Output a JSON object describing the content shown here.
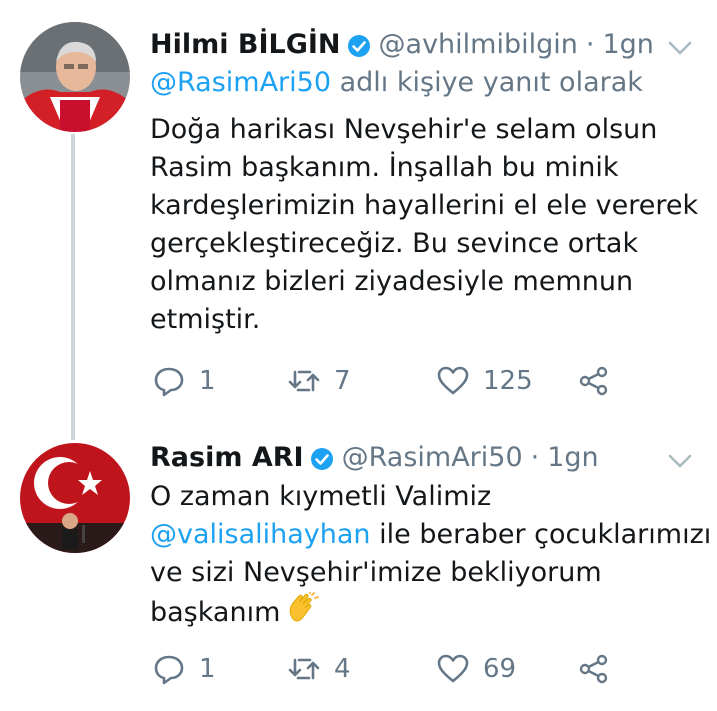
{
  "tweets": [
    {
      "name": "Hilmi BİLGİN",
      "handle": "@avhilmibilgin",
      "separator": "·",
      "time": "1gn",
      "reply_prefix_mention": "@RasimAri50",
      "reply_suffix": " adlı kişiye yanıt olarak",
      "lines": [
        "Doğa harikası Nevşehir'e selam olsun",
        "Rasim başkanım. İnşallah bu minik",
        "kardeşlerimizin hayallerini el ele vererek",
        "gerçekleştireceğiz. Bu sevince ortak",
        "olmanız bizleri ziyadesiyle memnun",
        "etmiştir."
      ],
      "replies": "1",
      "retweets": "7",
      "likes": "125"
    },
    {
      "name": "Rasim ARI",
      "handle": "@RasimAri50",
      "separator": "·",
      "time": "1gn",
      "line1": "O zaman kıymetli Valimiz",
      "line2_mention": "@valisalihayhan",
      "line2_rest": " ile beraber çocuklarımızı",
      "line3": "ve sizi Nevşehir'imize bekliyorum",
      "line4": "başkanım",
      "emoji": "clapping-hands",
      "replies": "1",
      "retweets": "4",
      "likes": "69"
    }
  ],
  "colors": {
    "text": "#14171a",
    "secondary": "#657786",
    "link": "#1da1f2",
    "verified": "#1da1f2",
    "thread_line": "#ccd6dd"
  }
}
